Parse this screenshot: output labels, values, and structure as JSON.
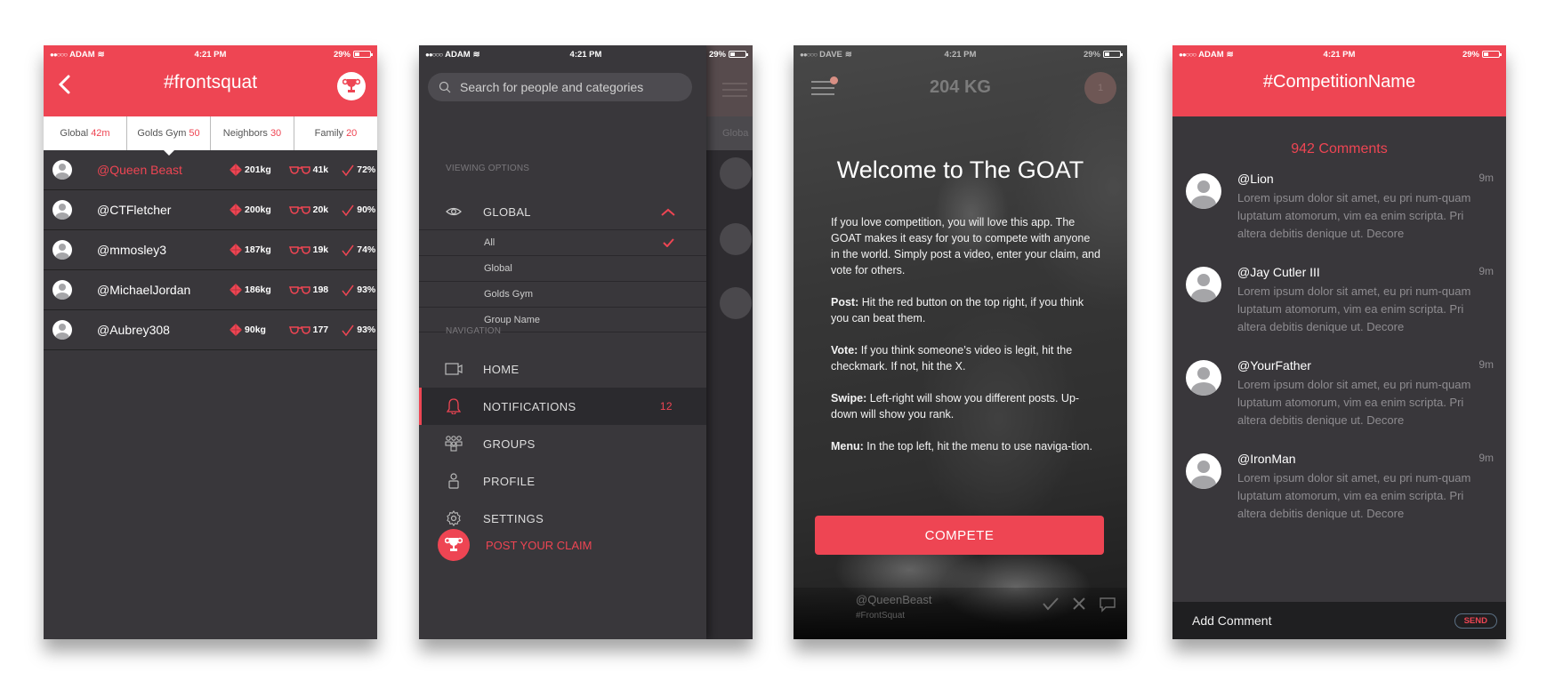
{
  "colors": {
    "accent": "#ee4553",
    "dark_bg": "#39373b",
    "composer_bg": "#1f1f21"
  },
  "screens": {
    "leaderboard": {
      "status": {
        "carrier": "ADAM",
        "time": "4:21 PM",
        "battery": "29%"
      },
      "title": "#frontsquat",
      "back_icon": "chevron-left-icon",
      "trophy_icon": "trophy-icon",
      "tabs": [
        {
          "label": "Global",
          "count": "42m",
          "active": false
        },
        {
          "label": "Golds Gym",
          "count": "50",
          "active": true
        },
        {
          "label": "Neighbors",
          "count": "30",
          "active": false
        },
        {
          "label": "Family",
          "count": "20",
          "active": false
        }
      ],
      "rows": [
        {
          "name": "@Queen Beast",
          "kg": "201kg",
          "views": "41k",
          "pct": "72%",
          "highlight": true
        },
        {
          "name": "@CTFletcher",
          "kg": "200kg",
          "views": "20k",
          "pct": "90%",
          "highlight": false
        },
        {
          "name": "@mmosley3",
          "kg": "187kg",
          "views": "19k",
          "pct": "74%",
          "highlight": false
        },
        {
          "name": "@MichaelJordan",
          "kg": "186kg",
          "views": "198",
          "pct": "93%",
          "highlight": false
        },
        {
          "name": "@Aubrey308",
          "kg": "90kg",
          "views": "177",
          "pct": "93%",
          "highlight": false
        }
      ]
    },
    "menu": {
      "status": {
        "carrier": "ADAM",
        "time": "4:21 PM",
        "battery": "29%"
      },
      "search_placeholder": "Search for people and categories",
      "viewing_label": "VIEWING OPTIONS",
      "viewing_selected": "GLOBAL",
      "viewing_options": [
        {
          "label": "All",
          "checked": true
        },
        {
          "label": "Global",
          "checked": false
        },
        {
          "label": "Golds Gym",
          "checked": false
        },
        {
          "label": "Group Name",
          "checked": false
        }
      ],
      "navigation_label": "NAVIGATION",
      "nav_items": [
        {
          "label": "HOME",
          "icon": "video-camera-icon",
          "badge": ""
        },
        {
          "label": "NOTIFICATIONS",
          "icon": "bell-icon",
          "badge": "12",
          "active": true
        },
        {
          "label": "GROUPS",
          "icon": "groups-icon",
          "badge": ""
        },
        {
          "label": "PROFILE",
          "icon": "person-icon",
          "badge": ""
        },
        {
          "label": "SETTINGS",
          "icon": "gear-icon",
          "badge": ""
        }
      ],
      "post_claim": "POST YOUR CLAIM",
      "behind_tab": "Globa"
    },
    "welcome": {
      "status": {
        "carrier": "DAVE",
        "time": "4:21 PM",
        "battery": "29%"
      },
      "weight": "204 KG",
      "rank": "1",
      "title": "Welcome to The GOAT",
      "intro": "If you love competition, you will love this app. The GOAT makes it easy for you to compete with anyone in the world. Simply post a video, enter your claim, and vote for others.",
      "tips": [
        {
          "term": "Post:",
          "text": " Hit the red button on the top right, if you think you can beat them."
        },
        {
          "term": "Vote:",
          "text": " If you think someone’s video is legit, hit the checkmark. If not, hit the X."
        },
        {
          "term": "Swipe:",
          "text": " Left-right will show you different posts. Up-down will show you rank."
        },
        {
          "term": "Menu:",
          "text": " In the top left, hit the menu to use naviga-tion."
        }
      ],
      "compete_label": "COMPETE",
      "post_user": "@QueenBeast",
      "post_tag": "#FrontSquat"
    },
    "comments": {
      "status": {
        "carrier": "ADAM",
        "time": "4:21 PM",
        "battery": "29%"
      },
      "title": "#CompetitionName",
      "count_label": "942 Comments",
      "items": [
        {
          "user": "@Lion",
          "time": "9m",
          "body": "Lorem ipsum dolor sit amet, eu pri num-quam luptatum atomorum, vim ea enim scripta. Pri altera debitis denique ut. Decore"
        },
        {
          "user": "@Jay Cutler III",
          "time": "9m",
          "body": "Lorem ipsum dolor sit amet, eu pri num-quam luptatum atomorum, vim ea enim scripta. Pri altera debitis denique ut. Decore"
        },
        {
          "user": "@YourFather",
          "time": "9m",
          "body": "Lorem ipsum dolor sit amet, eu pri num-quam luptatum atomorum, vim ea enim scripta. Pri altera debitis denique ut. Decore"
        },
        {
          "user": "@IronMan",
          "time": "9m",
          "body": "Lorem ipsum dolor sit amet, eu pri num-quam luptatum atomorum, vim ea enim scripta. Pri altera debitis denique ut. Decore"
        }
      ],
      "input_placeholder": "Add Comment",
      "send_label": "SEND"
    }
  }
}
